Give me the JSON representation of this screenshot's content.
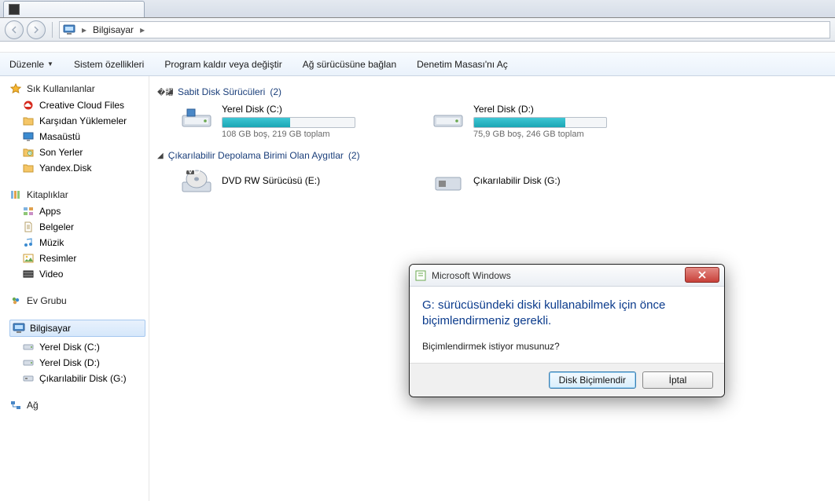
{
  "tab": {
    "title": ""
  },
  "breadcrumb": {
    "item": "Bilgisayar"
  },
  "toolbar": {
    "organize": "Düzenle",
    "system_props": "Sistem özellikleri",
    "uninstall": "Program kaldır veya değiştir",
    "map_drive": "Ağ sürücüsüne bağlan",
    "control_panel": "Denetim Masası'nı Aç"
  },
  "sidebar": {
    "favorites": {
      "title": "Sık Kullanılanlar",
      "items": [
        "Creative Cloud Files",
        "Karşıdan Yüklemeler",
        "Masaüstü",
        "Son Yerler",
        "Yandex.Disk"
      ]
    },
    "libraries": {
      "title": "Kitaplıklar",
      "items": [
        "Apps",
        "Belgeler",
        "Müzik",
        "Resimler",
        "Video"
      ]
    },
    "homegroup": {
      "title": "Ev Grubu"
    },
    "computer": {
      "title": "Bilgisayar",
      "items": [
        "Yerel Disk (C:)",
        "Yerel Disk (D:)",
        "Çıkarılabilir Disk (G:)"
      ]
    },
    "network": {
      "title": "Ağ"
    }
  },
  "groups": {
    "hdd": {
      "title": "Sabit Disk Sürücüleri",
      "count": "(2)"
    },
    "removable": {
      "title": "Çıkarılabilir Depolama Birimi Olan Aygıtlar",
      "count": "(2)"
    }
  },
  "drives": {
    "c": {
      "name": "Yerel Disk (C:)",
      "stats": "108 GB boş, 219 GB toplam",
      "fill": 51
    },
    "d": {
      "name": "Yerel Disk (D:)",
      "stats": "75,9 GB boş, 246 GB toplam",
      "fill": 69
    },
    "e": {
      "name": "DVD RW Sürücüsü (E:)"
    },
    "g": {
      "name": "Çıkarılabilir Disk (G:)"
    }
  },
  "dialog": {
    "title": "Microsoft Windows",
    "main": "G: sürücüsündeki diski kullanabilmek için önce biçimlendirmeniz gerekli.",
    "sub": "Biçimlendirmek istiyor musunuz?",
    "format_btn": "Disk Biçimlendir",
    "cancel_btn": "İptal"
  }
}
